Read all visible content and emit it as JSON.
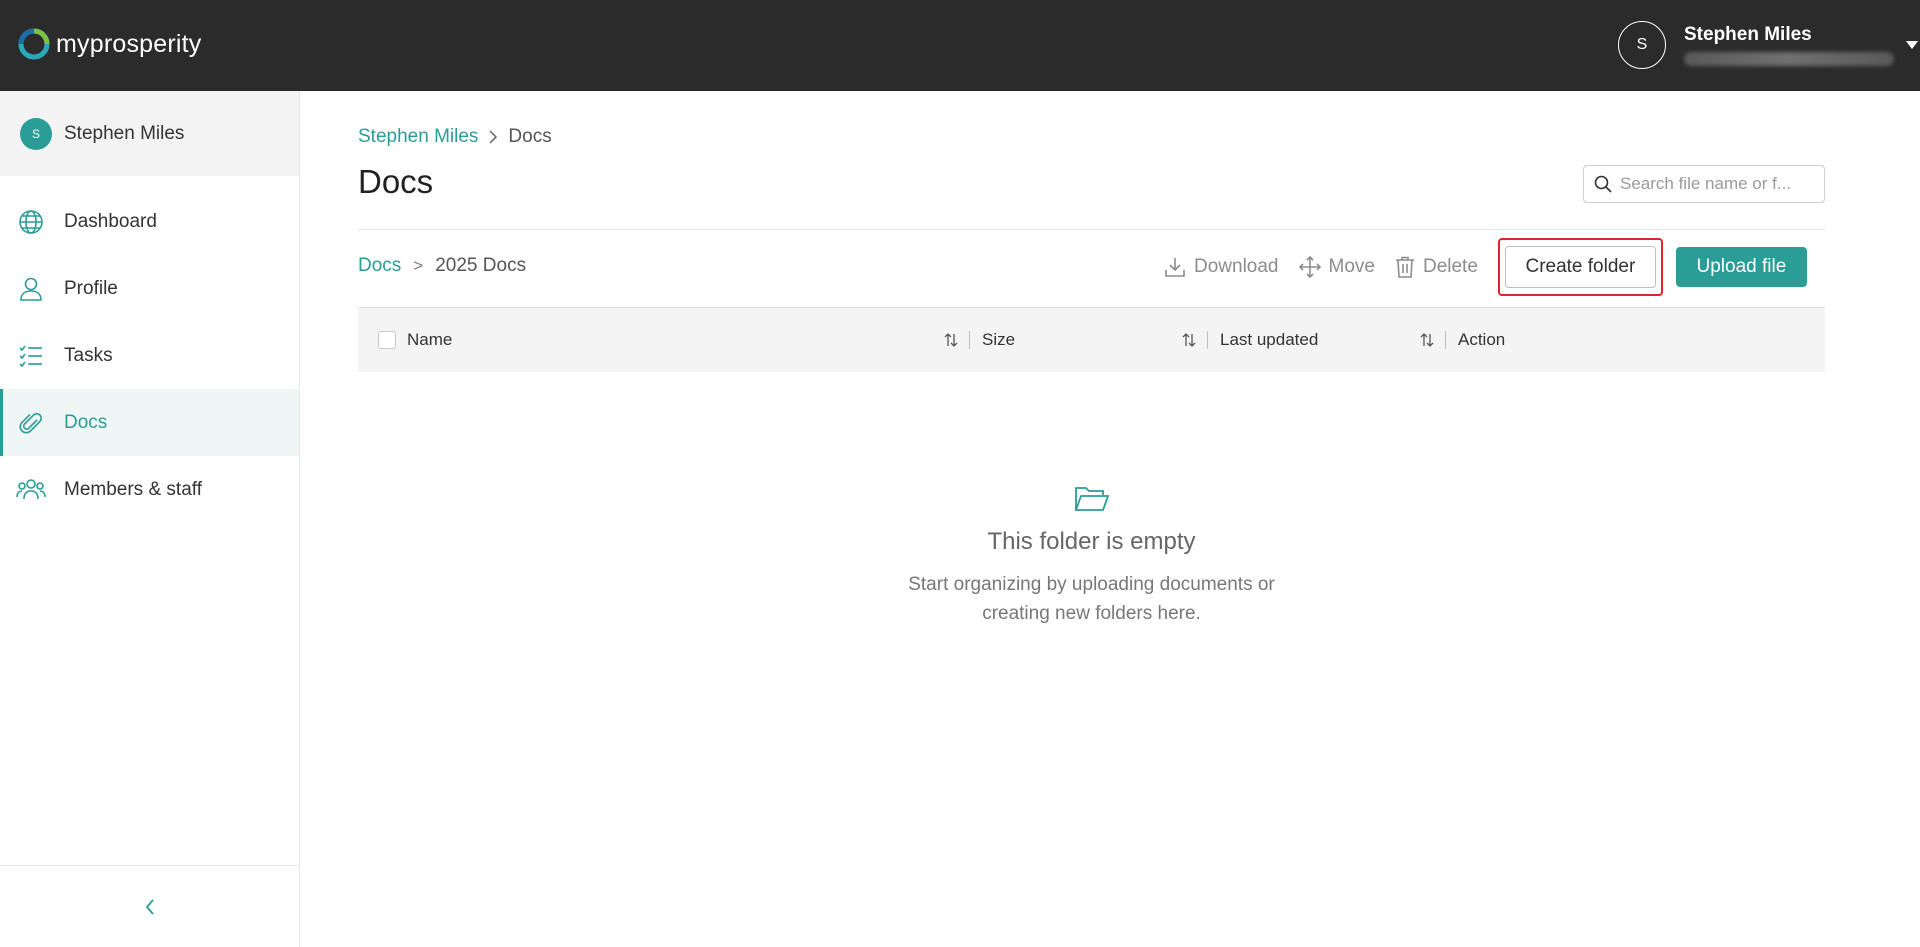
{
  "header": {
    "logo_text": "myprosperity",
    "user": {
      "initial": "S",
      "name": "Stephen Miles"
    }
  },
  "sidebar": {
    "user": {
      "initial": "S",
      "name": "Stephen Miles"
    },
    "items": [
      {
        "label": "Dashboard",
        "icon": "globe-icon"
      },
      {
        "label": "Profile",
        "icon": "user-icon"
      },
      {
        "label": "Tasks",
        "icon": "checklist-icon"
      },
      {
        "label": "Docs",
        "icon": "paperclip-icon",
        "active": true
      },
      {
        "label": "Members & staff",
        "icon": "people-icon"
      }
    ]
  },
  "main": {
    "breadcrumb": {
      "root": "Stephen Miles",
      "current": "Docs"
    },
    "title": "Docs",
    "search": {
      "placeholder": "Search file name or f..."
    },
    "folder_path": {
      "root": "Docs",
      "separator": ">",
      "current": "2025 Docs"
    },
    "toolbar": {
      "download": "Download",
      "move": "Move",
      "delete": "Delete",
      "create_folder": "Create folder",
      "upload_file": "Upload file"
    },
    "table": {
      "columns": [
        "Name",
        "Size",
        "Last updated",
        "Action"
      ]
    },
    "empty_state": {
      "title": "This folder is empty",
      "line1": "Start organizing by uploading documents or",
      "line2": "creating new folders here."
    }
  },
  "colors": {
    "accent": "#2a9d96",
    "topbar": "#2b2b2b",
    "highlight": "#e0232d"
  }
}
